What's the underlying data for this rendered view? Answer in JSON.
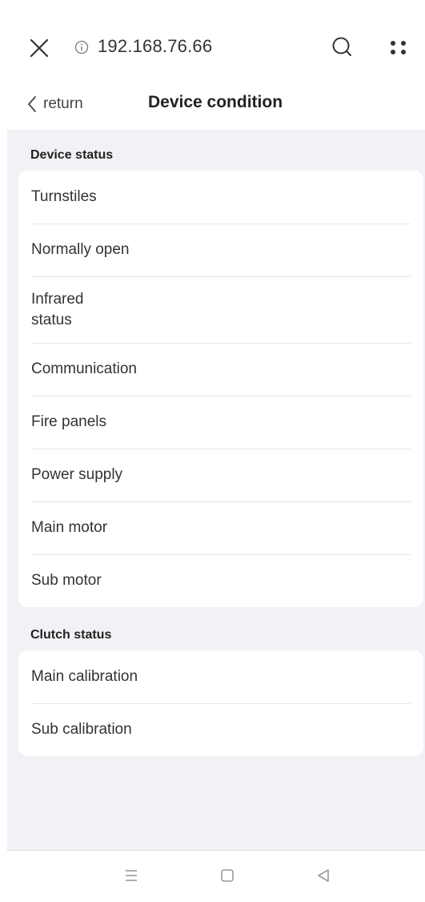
{
  "browser": {
    "url": "192.168.76.66",
    "icons": [
      "close-icon",
      "info-icon",
      "search-icon",
      "more-icon"
    ]
  },
  "header": {
    "back_label": "return",
    "title": "Device condition"
  },
  "sections": [
    {
      "title": "Device status",
      "items": [
        "Turnstiles",
        "Normally open",
        "Infrared\nstatus",
        "Communication",
        "Fire panels",
        "Power supply",
        "Main motor",
        "Sub motor"
      ]
    },
    {
      "title": "Clutch status",
      "items": [
        "Main calibration",
        "Sub calibration"
      ]
    }
  ],
  "navbar": {
    "icons": [
      "menu-icon",
      "home-icon",
      "back-icon"
    ]
  },
  "colors": {
    "background": "#f1f2f5",
    "card": "#ffffff",
    "divider": "#e6e6e6",
    "text": "#333333"
  }
}
